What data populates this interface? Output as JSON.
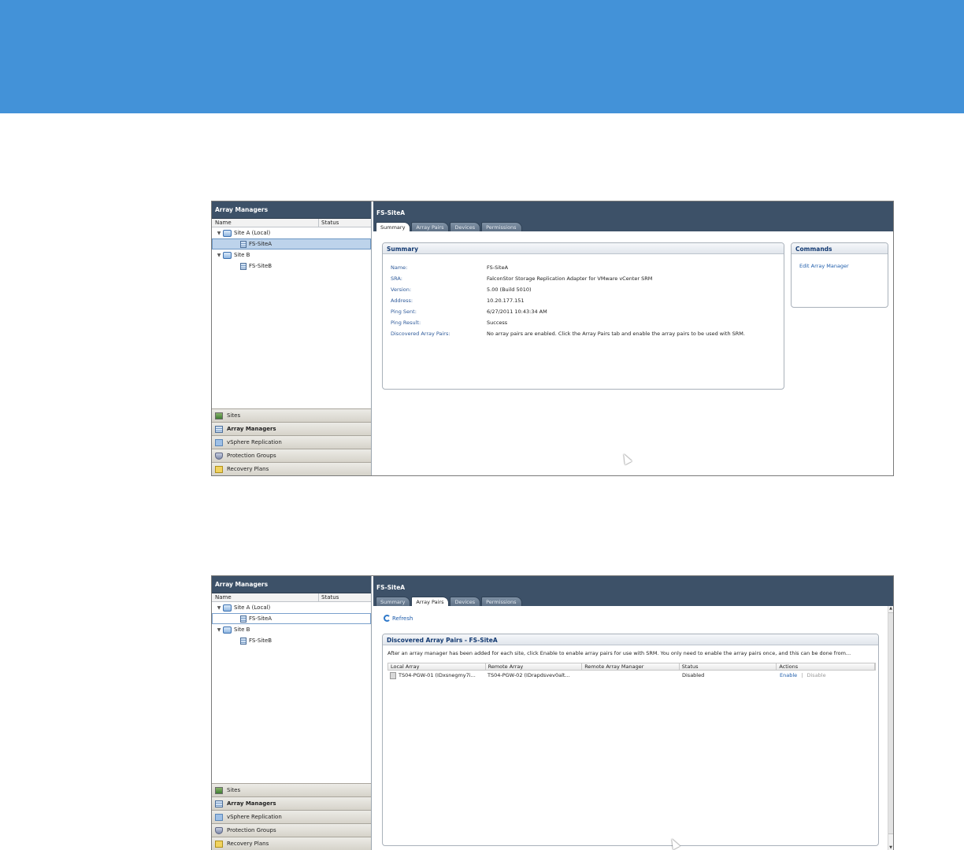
{
  "shots": [
    {
      "left": {
        "title": "Array Managers",
        "columns": [
          "Name",
          "Status"
        ],
        "tree": [
          {
            "label": "Site A (Local)",
            "type": "site",
            "expanded": true
          },
          {
            "label": "FS-SiteA",
            "type": "array",
            "selected": true
          },
          {
            "label": "Site B",
            "type": "site",
            "expanded": true
          },
          {
            "label": "FS-SiteB",
            "type": "array"
          }
        ],
        "nav": [
          {
            "label": "Sites",
            "icon": "sites-icon"
          },
          {
            "label": "Array Managers",
            "icon": "array-managers-icon",
            "active": true
          },
          {
            "label": "vSphere Replication",
            "icon": "vsphere-replication-icon"
          },
          {
            "label": "Protection Groups",
            "icon": "protection-groups-icon"
          },
          {
            "label": "Recovery Plans",
            "icon": "recovery-plans-icon"
          }
        ]
      },
      "right": {
        "title": "FS-SiteA",
        "tabs": [
          "Summary",
          "Array Pairs",
          "Devices",
          "Permissions"
        ],
        "active_tab": "Summary",
        "summary": {
          "title": "Summary",
          "rows": [
            {
              "key": "Name:",
              "value": "FS-SiteA"
            },
            {
              "key": "SRA:",
              "value": "FalconStor Storage Replication Adapter for VMware vCenter SRM"
            },
            {
              "key": "Version:",
              "value": "5.00 (Build 5010)"
            },
            {
              "key": "Address:",
              "value": "10.20.177.151"
            },
            {
              "key": "Ping Sent:",
              "value": "6/27/2011 10:43:34 AM"
            },
            {
              "key": "Ping Result:",
              "value": "Success"
            },
            {
              "key": "Discovered Array Pairs:",
              "value": "No array pairs are enabled. Click the Array Pairs tab and enable the array pairs to be used with SRM."
            }
          ]
        },
        "commands": {
          "title": "Commands",
          "items": [
            "Edit Array Manager"
          ]
        }
      }
    },
    {
      "left": {
        "title": "Array Managers",
        "columns": [
          "Name",
          "Status"
        ],
        "tree": [
          {
            "label": "Site A (Local)",
            "type": "site",
            "expanded": true
          },
          {
            "label": "FS-SiteA",
            "type": "array",
            "selected": true
          },
          {
            "label": "Site B",
            "type": "site",
            "expanded": true
          },
          {
            "label": "FS-SiteB",
            "type": "array"
          }
        ],
        "nav": [
          {
            "label": "Sites",
            "icon": "sites-icon"
          },
          {
            "label": "Array Managers",
            "icon": "array-managers-icon",
            "active": true
          },
          {
            "label": "vSphere Replication",
            "icon": "vsphere-replication-icon"
          },
          {
            "label": "Protection Groups",
            "icon": "protection-groups-icon"
          },
          {
            "label": "Recovery Plans",
            "icon": "recovery-plans-icon"
          }
        ]
      },
      "right": {
        "title": "FS-SiteA",
        "tabs": [
          "Summary",
          "Array Pairs",
          "Devices",
          "Permissions"
        ],
        "active_tab": "Array Pairs",
        "refresh_label": "Refresh",
        "pairs": {
          "title": "Discovered Array Pairs - FS-SiteA",
          "description": "After an array manager has been added for each site, click Enable to enable array pairs for use with SRM. You only need to enable the array pairs once, and this can be done from...",
          "columns": [
            "Local Array",
            "Remote Array",
            "Remote Array Manager",
            "Status",
            "Actions"
          ],
          "rows": [
            {
              "local": "TS04-PGW-01 (IDxsnegmy7i...",
              "remote": "TS04-PGW-02 (IDrapdsvev0alt...",
              "remote_manager": "",
              "status": "Disabled",
              "enable": "Enable",
              "separator": "|",
              "disable": "Disable"
            }
          ]
        }
      }
    }
  ]
}
